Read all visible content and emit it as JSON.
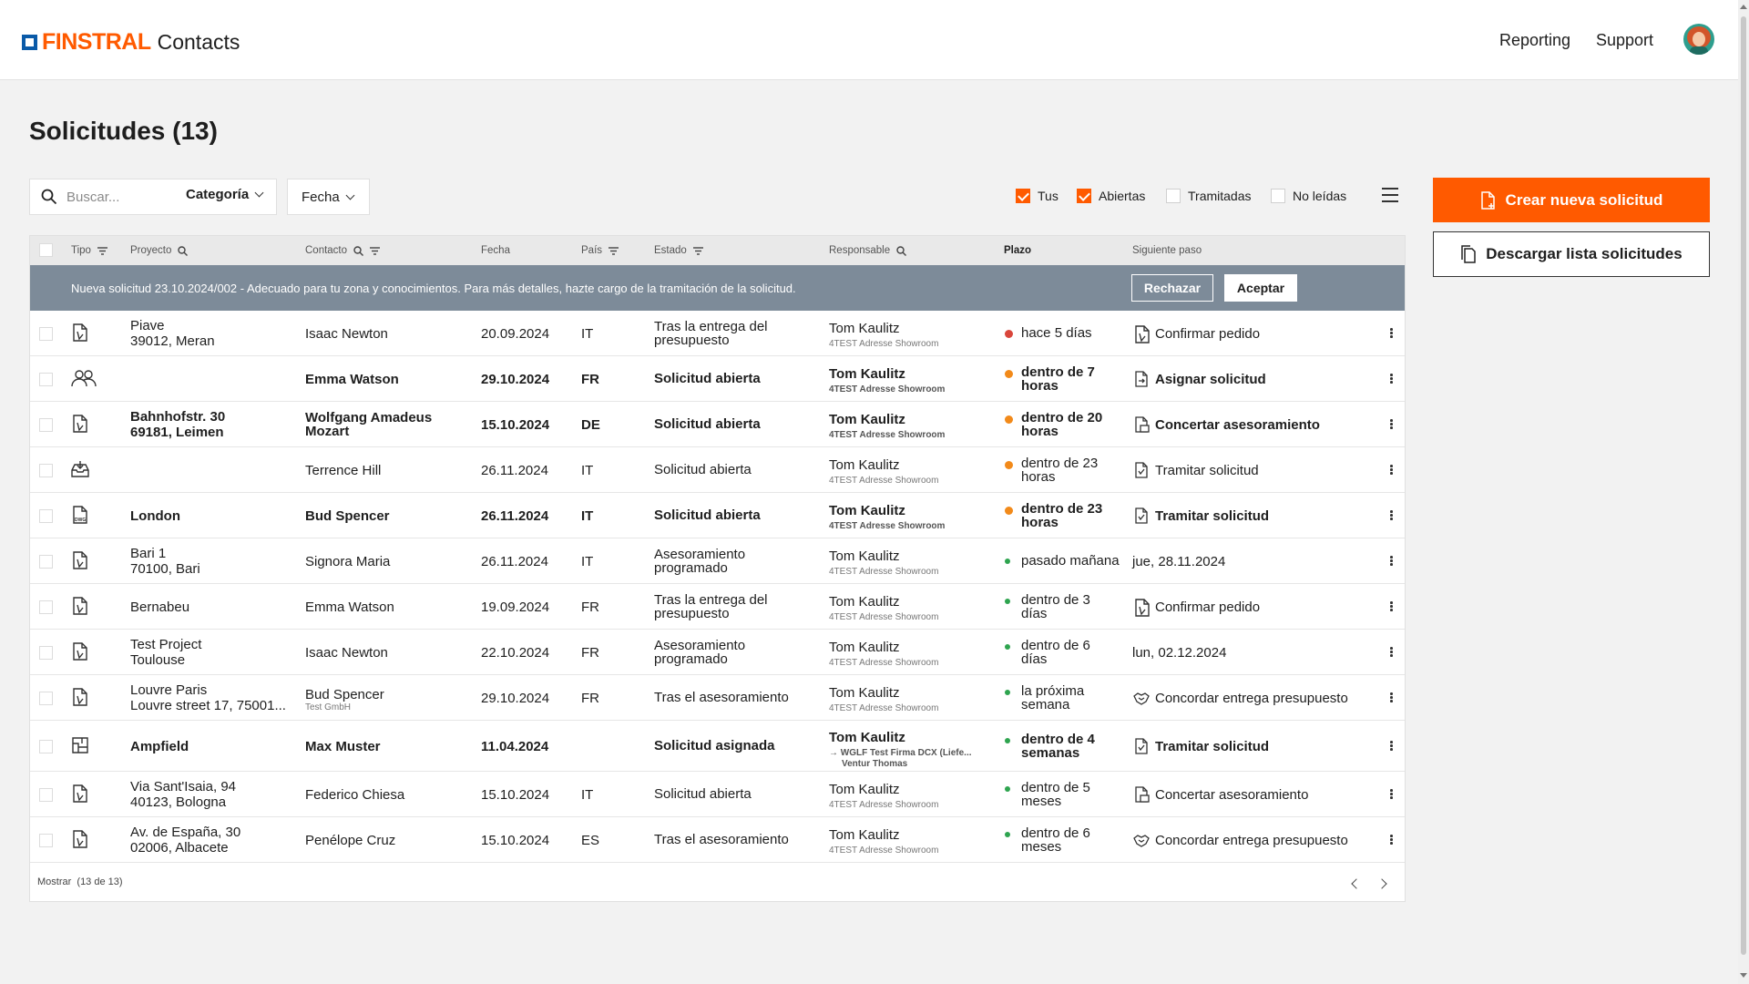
{
  "header": {
    "brand": "FINSTRAL",
    "app_name": "Contacts",
    "nav": [
      "Reporting",
      "Support"
    ]
  },
  "page": {
    "title": "Solicitudes (13)"
  },
  "filters": {
    "search_placeholder": "Buscar...",
    "category_label": "Categoría",
    "date_label": "Fecha",
    "checkboxes": [
      {
        "label": "Tus",
        "checked": true
      },
      {
        "label": "Abiertas",
        "checked": true
      },
      {
        "label": "Tramitadas",
        "checked": false
      },
      {
        "label": "No leídas",
        "checked": false
      }
    ]
  },
  "actions": {
    "create": "Crear nueva solicitud",
    "download": "Descargar lista solicitudes"
  },
  "table": {
    "columns": [
      "Tipo",
      "Proyecto",
      "Contacto",
      "Fecha",
      "País",
      "Estado",
      "Responsable",
      "Plazo",
      "Siguiente paso"
    ],
    "banner": {
      "text": "Nueva solicitud 23.10.2024/002 - Adecuado para tu zona y conocimientos. Para más detalles, hazte cargo de la tramitación de la solicitud.",
      "reject": "Rechazar",
      "accept": "Aceptar"
    },
    "rows": [
      {
        "icon": "order-doc-icon",
        "bold": false,
        "project": [
          "Piave",
          "39012, Meran"
        ],
        "contact": "Isaac Newton",
        "contact_sub": "",
        "date": "20.09.2024",
        "country": "IT",
        "status": [
          "Tras la entrega del",
          "presupuesto"
        ],
        "owner": "Tom Kaulitz",
        "owner_sub": [
          "4TEST Adresse Showroom"
        ],
        "deadline": [
          "hace 5 días"
        ],
        "dot": "#d9463b",
        "dot_small": false,
        "step_icon": "order-doc-icon",
        "next": "Confirmar pedido"
      },
      {
        "icon": "people-icon",
        "bold": true,
        "project": [],
        "contact": "Emma Watson",
        "contact_sub": "",
        "date": "29.10.2024",
        "country": "FR",
        "status": [
          "Solicitud abierta"
        ],
        "owner": "Tom Kaulitz",
        "owner_sub": [
          "4TEST Adresse Showroom"
        ],
        "deadline": [
          "dentro de 7",
          "horas"
        ],
        "dot": "#f28a1a",
        "dot_small": false,
        "step_icon": "assign-doc-icon",
        "next": "Asignar solicitud"
      },
      {
        "icon": "order-doc-icon",
        "bold": true,
        "project": [
          "Bahnhofstr. 30",
          "69181, Leimen"
        ],
        "contact": "Wolfgang Amadeus",
        "contact2": "Mozart",
        "contact_sub": "",
        "date": "15.10.2024",
        "country": "DE",
        "status": [
          "Solicitud abierta"
        ],
        "owner": "Tom Kaulitz",
        "owner_sub": [
          "4TEST Adresse Showroom"
        ],
        "deadline": [
          "dentro de 20",
          "horas"
        ],
        "dot": "#f28a1a",
        "dot_small": false,
        "step_icon": "consult-doc-icon",
        "next": "Concertar asesoramiento"
      },
      {
        "icon": "inbox-icon",
        "bold": false,
        "project": [],
        "contact": "Terrence Hill",
        "contact_sub": "",
        "date": "26.11.2024",
        "country": "IT",
        "status": [
          "Solicitud abierta"
        ],
        "owner": "Tom Kaulitz",
        "owner_sub": [
          "4TEST Adresse Showroom"
        ],
        "deadline": [
          "dentro de 23",
          "horas"
        ],
        "dot": "#f28a1a",
        "dot_small": false,
        "step_icon": "process-doc-icon",
        "next": "Tramitar solicitud"
      },
      {
        "icon": "dwg-file-icon",
        "bold": true,
        "project": [
          "London"
        ],
        "contact": "Bud Spencer",
        "contact_sub": "",
        "date": "26.11.2024",
        "country": "IT",
        "status": [
          "Solicitud abierta"
        ],
        "owner": "Tom Kaulitz",
        "owner_sub": [
          "4TEST Adresse Showroom"
        ],
        "deadline": [
          "dentro de 23",
          "horas"
        ],
        "dot": "#f28a1a",
        "dot_small": false,
        "step_icon": "process-doc-icon",
        "next": "Tramitar solicitud"
      },
      {
        "icon": "order-doc-icon",
        "bold": false,
        "project": [
          "Bari 1",
          "70100, Bari"
        ],
        "contact": "Signora Maria",
        "contact_sub": "",
        "date": "26.11.2024",
        "country": "IT",
        "status": [
          "Asesoramiento",
          "programado"
        ],
        "owner": "Tom Kaulitz",
        "owner_sub": [
          "4TEST Adresse Showroom"
        ],
        "deadline": [
          "pasado mañana"
        ],
        "dot": "#2ea44f",
        "dot_small": true,
        "step_icon": "",
        "next": "jue, 28.11.2024"
      },
      {
        "icon": "order-doc-icon",
        "bold": false,
        "project": [
          "Bernabeu"
        ],
        "contact": "Emma Watson",
        "contact_sub": "",
        "date": "19.09.2024",
        "country": "FR",
        "status": [
          "Tras la entrega del",
          "presupuesto"
        ],
        "owner": "Tom Kaulitz",
        "owner_sub": [
          "4TEST Adresse Showroom"
        ],
        "deadline": [
          "dentro de 3",
          "días"
        ],
        "dot": "#2ea44f",
        "dot_small": true,
        "step_icon": "order-doc-icon",
        "next": "Confirmar pedido"
      },
      {
        "icon": "order-doc-icon",
        "bold": false,
        "project": [
          "Test Project",
          "Toulouse"
        ],
        "contact": "Isaac Newton",
        "contact_sub": "",
        "date": "22.10.2024",
        "country": "FR",
        "status": [
          "Asesoramiento",
          "programado"
        ],
        "owner": "Tom Kaulitz",
        "owner_sub": [
          "4TEST Adresse Showroom"
        ],
        "deadline": [
          "dentro de 6",
          "días"
        ],
        "dot": "#2ea44f",
        "dot_small": true,
        "step_icon": "",
        "next": "lun, 02.12.2024"
      },
      {
        "icon": "order-doc-icon",
        "bold": false,
        "project": [
          "Louvre Paris",
          "Louvre street 17, 75001..."
        ],
        "contact": "Bud Spencer",
        "contact_sub": "Test GmbH",
        "date": "29.10.2024",
        "country": "FR",
        "status": [
          "Tras el asesoramiento"
        ],
        "owner": "Tom Kaulitz",
        "owner_sub": [
          "4TEST Adresse Showroom"
        ],
        "deadline": [
          "la próxima",
          "semana"
        ],
        "dot": "#2ea44f",
        "dot_small": true,
        "step_icon": "handshake-icon",
        "next": "Concordar entrega presupuesto"
      },
      {
        "icon": "plan-doc-icon",
        "bold": true,
        "project": [
          "Ampfield"
        ],
        "contact": "Max Muster",
        "contact_sub": "",
        "date": "11.04.2024",
        "country": "",
        "status": [
          "Solicitud asignada"
        ],
        "owner": "Tom Kaulitz",
        "owner_sub": [
          "→ WGLF Test Firma DCX (Liefe...",
          "Ventur Thomas"
        ],
        "deadline": [
          "dentro de 4",
          "semanas"
        ],
        "dot": "#2ea44f",
        "dot_small": true,
        "step_icon": "process-doc-icon",
        "next": "Tramitar solicitud"
      },
      {
        "icon": "order-doc-icon",
        "bold": false,
        "project": [
          "Via Sant'Isaia, 94",
          "40123, Bologna"
        ],
        "contact": "Federico Chiesa",
        "contact_sub": "",
        "date": "15.10.2024",
        "country": "IT",
        "status": [
          "Solicitud abierta"
        ],
        "owner": "Tom Kaulitz",
        "owner_sub": [
          "4TEST Adresse Showroom"
        ],
        "deadline": [
          "dentro de 5",
          "meses"
        ],
        "dot": "#2ea44f",
        "dot_small": true,
        "step_icon": "consult-doc-icon",
        "next": "Concertar asesoramiento"
      },
      {
        "icon": "order-doc-icon",
        "bold": false,
        "project": [
          "Av. de España, 30",
          "02006, Albacete"
        ],
        "contact": "Penélope Cruz",
        "contact_sub": "",
        "date": "15.10.2024",
        "country": "ES",
        "status": [
          "Tras el asesoramiento"
        ],
        "owner": "Tom Kaulitz",
        "owner_sub": [
          "4TEST Adresse Showroom"
        ],
        "deadline": [
          "dentro de 6",
          "meses"
        ],
        "dot": "#2ea44f",
        "dot_small": true,
        "step_icon": "handshake-icon",
        "next": "Concordar entrega presupuesto"
      }
    ],
    "footer": {
      "label": "Mostrar",
      "count": "(13 de 13)"
    }
  },
  "colors": {
    "accent": "#ff5a00",
    "brand_blue": "#0a5aa8",
    "banner": "#7d8b99"
  }
}
